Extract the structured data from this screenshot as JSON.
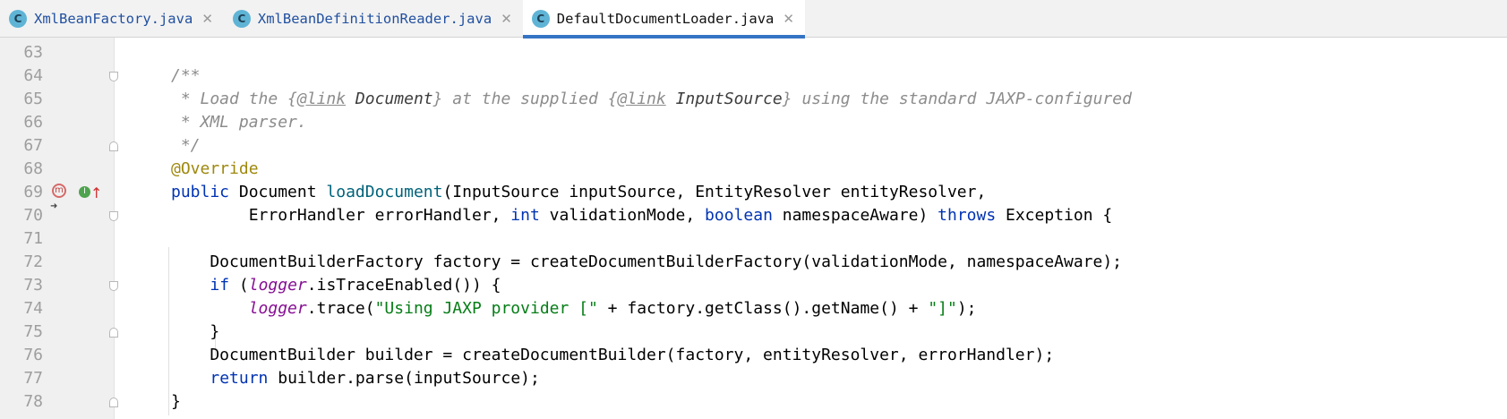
{
  "tabs": [
    {
      "icon": "C",
      "label": "XmlBeanFactory.java",
      "close": "✕",
      "active": false
    },
    {
      "icon": "C",
      "label": "XmlBeanDefinitionReader.java",
      "close": "✕",
      "active": false
    },
    {
      "icon": "C",
      "label": "DefaultDocumentLoader.java",
      "close": "✕",
      "active": true
    }
  ],
  "colors": {
    "accent": "#3574c4",
    "keyword": "#0033b3",
    "method": "#00627a",
    "field": "#871094",
    "string": "#067d17",
    "annotation": "#9e880d",
    "comment": "#8c8c8c"
  },
  "gutter_icons": {
    "method_marker": "m",
    "implements_marker": "I"
  },
  "lines": [
    {
      "n": "63",
      "tokens": []
    },
    {
      "n": "64",
      "tokens": [
        {
          "t": "/**",
          "c": "comment"
        }
      ]
    },
    {
      "n": "65",
      "tokens": [
        {
          "t": " * Load the {",
          "c": "comment"
        },
        {
          "t": "@link",
          "c": "doc-tag"
        },
        {
          "t": " ",
          "c": "comment"
        },
        {
          "t": "Document",
          "c": "doc-ref"
        },
        {
          "t": "} at the supplied {",
          "c": "comment"
        },
        {
          "t": "@link",
          "c": "doc-tag"
        },
        {
          "t": " ",
          "c": "comment"
        },
        {
          "t": "InputSource",
          "c": "doc-ref"
        },
        {
          "t": "} using the standard JAXP-configured",
          "c": "comment"
        }
      ]
    },
    {
      "n": "66",
      "tokens": [
        {
          "t": " * XML parser.",
          "c": "comment"
        }
      ]
    },
    {
      "n": "67",
      "tokens": [
        {
          "t": " */",
          "c": "comment"
        }
      ]
    },
    {
      "n": "68",
      "tokens": [
        {
          "t": "@Override",
          "c": "annot"
        }
      ]
    },
    {
      "n": "69",
      "tokens": [
        {
          "t": "public",
          "c": "kw"
        },
        {
          "t": " Document ",
          "c": ""
        },
        {
          "t": "loadDocument",
          "c": "method"
        },
        {
          "t": "(InputSource inputSource, EntityResolver entityResolver,",
          "c": ""
        }
      ]
    },
    {
      "n": "70",
      "tokens": [
        {
          "t": "        ErrorHandler errorHandler, ",
          "c": ""
        },
        {
          "t": "int",
          "c": "kw"
        },
        {
          "t": " validationMode, ",
          "c": ""
        },
        {
          "t": "boolean",
          "c": "kw"
        },
        {
          "t": " namespaceAware) ",
          "c": ""
        },
        {
          "t": "throws",
          "c": "kw"
        },
        {
          "t": " Exception {",
          "c": ""
        }
      ]
    },
    {
      "n": "71",
      "tokens": []
    },
    {
      "n": "72",
      "tokens": [
        {
          "t": "    DocumentBuilderFactory factory = createDocumentBuilderFactory(validationMode, namespaceAware);",
          "c": ""
        }
      ]
    },
    {
      "n": "73",
      "tokens": [
        {
          "t": "    ",
          "c": ""
        },
        {
          "t": "if",
          "c": "kw"
        },
        {
          "t": " (",
          "c": ""
        },
        {
          "t": "logger",
          "c": "field"
        },
        {
          "t": ".isTraceEnabled()) {",
          "c": ""
        }
      ]
    },
    {
      "n": "74",
      "tokens": [
        {
          "t": "        ",
          "c": ""
        },
        {
          "t": "logger",
          "c": "field"
        },
        {
          "t": ".trace(",
          "c": ""
        },
        {
          "t": "\"Using JAXP provider [\"",
          "c": "str"
        },
        {
          "t": " + factory.getClass().getName() + ",
          "c": ""
        },
        {
          "t": "\"]\"",
          "c": "str"
        },
        {
          "t": ");",
          "c": ""
        }
      ]
    },
    {
      "n": "75",
      "tokens": [
        {
          "t": "    }",
          "c": ""
        }
      ]
    },
    {
      "n": "76",
      "tokens": [
        {
          "t": "    DocumentBuilder builder = createDocumentBuilder(factory, entityResolver, errorHandler);",
          "c": ""
        }
      ]
    },
    {
      "n": "77",
      "tokens": [
        {
          "t": "    ",
          "c": ""
        },
        {
          "t": "return",
          "c": "kw"
        },
        {
          "t": " builder.parse(inputSource);",
          "c": ""
        }
      ]
    },
    {
      "n": "78",
      "tokens": [
        {
          "t": "}",
          "c": ""
        }
      ]
    }
  ]
}
